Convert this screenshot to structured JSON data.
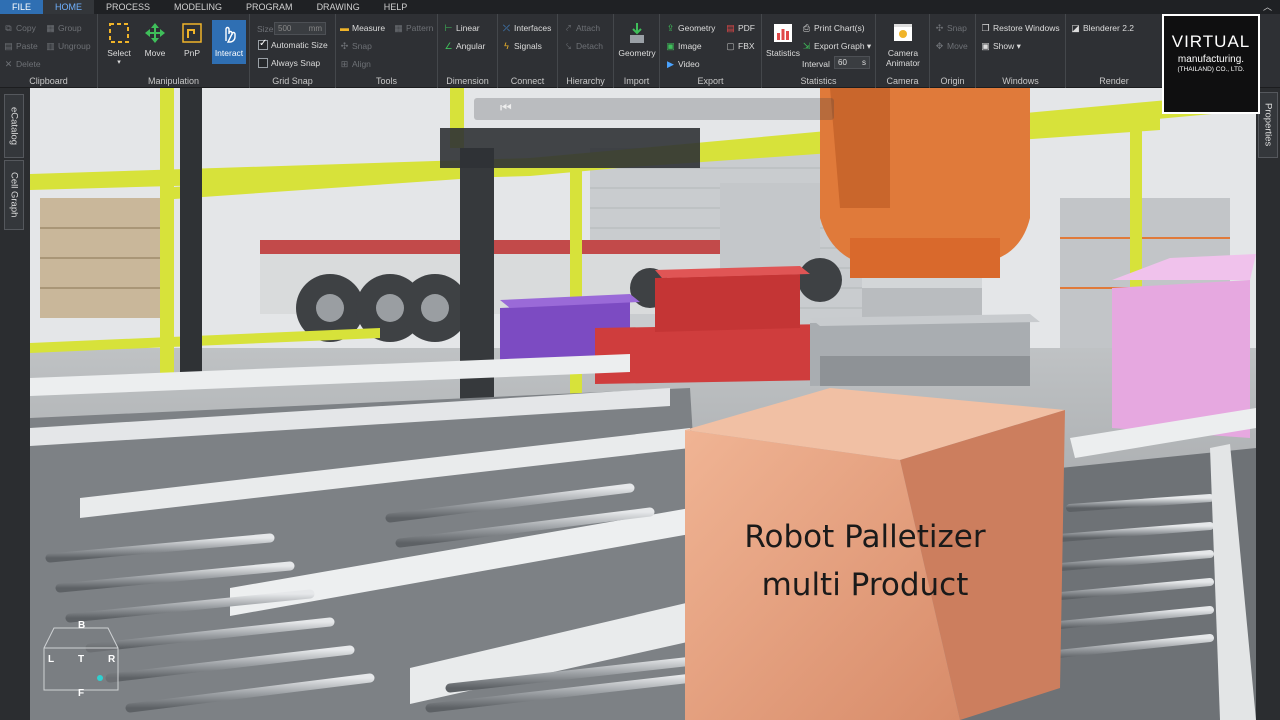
{
  "menu": {
    "items": [
      "FILE",
      "HOME",
      "PROCESS",
      "MODELING",
      "PROGRAM",
      "DRAWING",
      "HELP"
    ],
    "active": "HOME"
  },
  "ribbon": {
    "clipboard": {
      "title": "Clipboard",
      "copy": "Copy",
      "paste": "Paste",
      "delete": "Delete",
      "group": "Group",
      "ungroup": "Ungroup"
    },
    "manipulation": {
      "title": "Manipulation",
      "select": "Select",
      "move": "Move",
      "pnp": "PnP",
      "interact": "Interact"
    },
    "gridsnap": {
      "title": "Grid Snap",
      "size_label": "Size",
      "size_value": "500",
      "size_unit": "mm",
      "automatic_size": "Automatic Size",
      "always_snap": "Always Snap"
    },
    "tools": {
      "title": "Tools",
      "measure": "Measure",
      "pattern": "Pattern",
      "snap": "Snap",
      "align": "Align"
    },
    "dimension": {
      "title": "Dimension",
      "linear": "Linear",
      "angular": "Angular"
    },
    "connect": {
      "title": "Connect",
      "interfaces": "Interfaces",
      "signals": "Signals"
    },
    "hierarchy": {
      "title": "Hierarchy",
      "attach": "Attach",
      "detach": "Detach"
    },
    "import": {
      "title": "Import",
      "geometry": "Geometry"
    },
    "export": {
      "title": "Export",
      "geometry": "Geometry",
      "image": "Image",
      "video": "Video",
      "pdf": "PDF",
      "fbx": "FBX"
    },
    "statistics": {
      "title": "Statistics",
      "statistics": "Statistics",
      "print_charts": "Print Chart(s)",
      "export_graph": "Export Graph ▾",
      "interval_label": "Interval",
      "interval_value": "60",
      "interval_unit": "s"
    },
    "camera": {
      "title": "Camera",
      "camera_animator": "Camera Animator"
    },
    "origin": {
      "title": "Origin",
      "snap": "Snap",
      "move": "Move"
    },
    "windows": {
      "title": "Windows",
      "restore_windows": "Restore Windows",
      "show": "Show ▾"
    },
    "render": {
      "title": "Render",
      "blenderer": "Blenderer 2.2"
    }
  },
  "logo": {
    "line1": "VIRTUAL",
    "line2": "manufacturing.",
    "line3": "(THAILAND) CO., LTD."
  },
  "sidetabs": {
    "ecatalog": "eCatalog",
    "cell_graph": "Cell Graph",
    "properties": "Properties"
  },
  "caption": {
    "line1": "Robot Palletizer",
    "line2": "multi Product"
  },
  "navcube": {
    "back": "B",
    "left": "L",
    "top": "T",
    "right": "R",
    "front": "F"
  },
  "colors": {
    "accent": "#2f6fb3",
    "yellow_frame": "#d7e23a",
    "robot_orange": "#e07a3a",
    "box_copper": "#e8a07e"
  }
}
